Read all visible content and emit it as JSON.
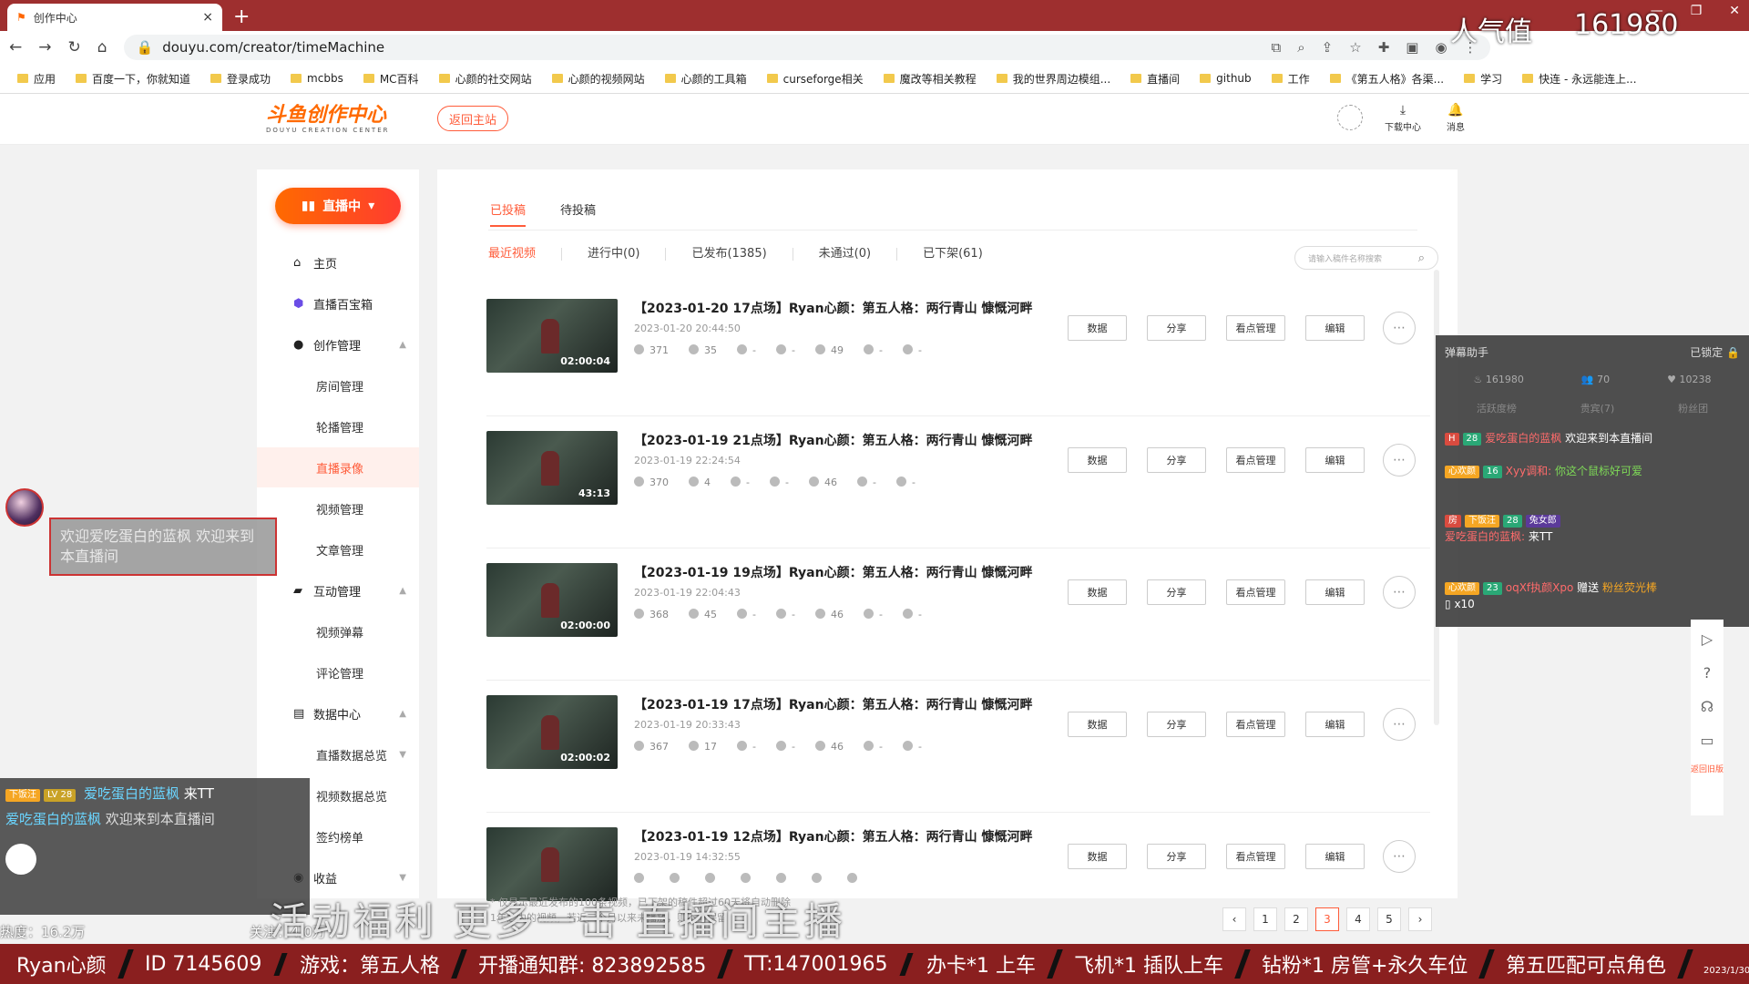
{
  "browser": {
    "tab_title": "创作中心",
    "url": "douyu.com/creator/timeMachine",
    "bookmarks": [
      "应用",
      "百度一下，你就知道",
      "登录成功",
      "mcbbs",
      "MC百科",
      "心颜的社交网站",
      "心颜的视频网站",
      "心颜的工具箱",
      "curseforge相关",
      "魔改等相关教程",
      "我的世界周边模组...",
      "直播间",
      "github",
      "工作",
      "《第五人格》各渠...",
      "学习",
      "快连 - 永远能连上..."
    ]
  },
  "header": {
    "logo_main": "斗鱼创作中心",
    "logo_sub": "DOUYU CREATION CENTER",
    "back_button": "返回主站",
    "download_label": "下载中心",
    "message_label": "消息"
  },
  "sidebar": {
    "live_button": "直播中",
    "items": {
      "home": "主页",
      "treasure": "直播百宝箱",
      "create": "创作管理",
      "room": "房间管理",
      "carousel": "轮播管理",
      "record": "直播录像",
      "video": "视频管理",
      "article": "文章管理",
      "interact": "互动管理",
      "video_danmaku": "视频弹幕",
      "comment": "评论管理",
      "data_center": "数据中心",
      "live_data": "直播数据总览",
      "video_data": "视频数据总览",
      "contract": "签约榜单",
      "income": "收益"
    }
  },
  "main": {
    "tabs": [
      "已投稿",
      "待投稿"
    ],
    "filters": [
      "最近视频",
      "进行中(0)",
      "已发布(1385)",
      "未通过(0)",
      "已下架(61)"
    ],
    "search_placeholder": "请输入稿件名称搜索",
    "actions": [
      "数据",
      "分享",
      "看点管理",
      "编辑"
    ],
    "rows": [
      {
        "title": "【2023-01-20 17点场】Ryan心颜：第五人格：两行青山 慷慨河畔",
        "date": "2023-01-20 20:44:50",
        "duration": "02:00:04",
        "plays": "371",
        "comments": "35",
        "s3": "-",
        "s4": "-",
        "likes": "49",
        "s6": "-",
        "s7": "-"
      },
      {
        "title": "【2023-01-19 21点场】Ryan心颜：第五人格：两行青山 慷慨河畔",
        "date": "2023-01-19 22:24:54",
        "duration": "43:13",
        "plays": "370",
        "comments": "4",
        "s3": "-",
        "s4": "-",
        "likes": "46",
        "s6": "-",
        "s7": "-"
      },
      {
        "title": "【2023-01-19 19点场】Ryan心颜：第五人格：两行青山 慷慨河畔",
        "date": "2023-01-19 22:04:43",
        "duration": "02:00:00",
        "plays": "368",
        "comments": "45",
        "s3": "-",
        "s4": "-",
        "likes": "46",
        "s6": "-",
        "s7": "-"
      },
      {
        "title": "【2023-01-19 17点场】Ryan心颜：第五人格：两行青山 慷慨河畔",
        "date": "2023-01-19 20:33:43",
        "duration": "02:00:02",
        "plays": "367",
        "comments": "17",
        "s3": "-",
        "s4": "-",
        "likes": "46",
        "s6": "-",
        "s7": "-"
      },
      {
        "title": "【2023-01-19 12点场】Ryan心颜：第五人格：两行青山 慷慨河畔",
        "date": "2023-01-19 14:32:55",
        "duration": "",
        "plays": "",
        "comments": "",
        "s3": "",
        "s4": "",
        "likes": "",
        "s6": "",
        "s7": ""
      }
    ],
    "footnote1": "* 仅显示最近发布的100条视频，已下架的稿件超过60天将自动删除",
    "footnote2": "1年之内的视频，若近三个月以来未播放，则不再保留",
    "pages": [
      "1",
      "2",
      "3",
      "4",
      "5"
    ],
    "current_page": "3"
  },
  "danmaku": {
    "title": "弹幕助手",
    "lock": "已锁定",
    "count1": "161980",
    "count2": "70",
    "count3": "10238",
    "tab1": "活跃度榜",
    "tab2": "贵宾(7)",
    "tab3": "粉丝团",
    "msgs": [
      {
        "b1": "28",
        "name": "爱吃蛋白的蓝枫",
        "text": "欢迎来到本直播间"
      },
      {
        "b1": "心欢颜",
        "b2": "16",
        "name": "Xyy调和:",
        "text": "你这个鼠标好可爱"
      },
      {
        "b1": "下饭汪",
        "b2": "28",
        "b3": "兔女郎",
        "name": "爱吃蛋白的蓝枫:",
        "text": "来TT"
      },
      {
        "b1": "心欢颜",
        "b2": "23",
        "name": "oqXf执颜Xpo",
        "text": "赠送",
        "gift": "粉丝荧光棒",
        "count": "x10"
      }
    ]
  },
  "tools": {
    "return_label": "返回旧版"
  },
  "overlay": {
    "renqi_label": "人气值",
    "renqi_value": "161980",
    "bubble": "欢迎爱吃蛋白的蓝枫 欢迎来到本直播间",
    "chat1_badge": "下饭汪",
    "chat1_lv": "LV 28",
    "chat1_name": "爱吃蛋白的蓝枫",
    "chat1_text": "来TT",
    "chat2_name": "爱吃蛋白的蓝枫",
    "chat2_text": "欢迎来到本直播间",
    "heat": "热度：16.2万",
    "guan": "关注：4.0万",
    "big": "活动福利 更多一击 直播间主播",
    "ticker": [
      "Ryan心颜",
      "ID 7145609",
      "游戏：第五人格",
      "开播通知群: 823892585",
      "TT:147001965",
      "办卡*1 上车",
      "飞机*1 插队上车",
      "钻粉*1 房管+永久车位",
      "第五匹配可点角色"
    ],
    "tray_date": "2023/1/30"
  }
}
